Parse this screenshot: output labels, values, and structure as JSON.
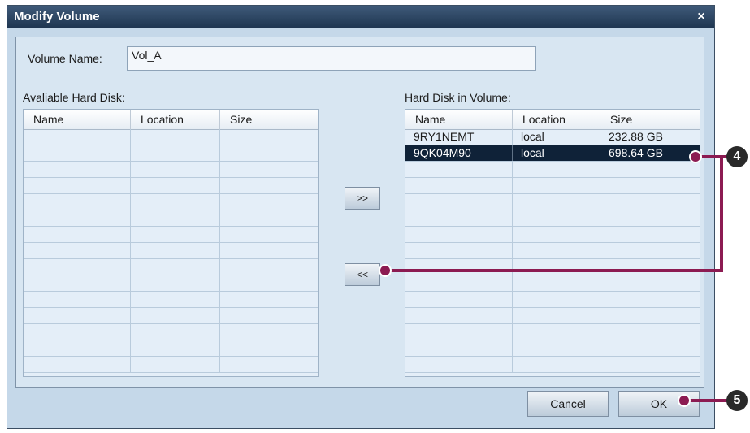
{
  "dialog": {
    "title": "Modify Volume",
    "close_glyph": "×",
    "volume_name_label": "Volume Name:",
    "volume_name_value": "Vol_A"
  },
  "available": {
    "label": "Avaliable Hard Disk:",
    "columns": [
      "Name",
      "Location",
      "Size"
    ],
    "rows": []
  },
  "in_volume": {
    "label": "Hard Disk in Volume:",
    "columns": [
      "Name",
      "Location",
      "Size"
    ],
    "rows": [
      {
        "name": "9RY1NEMT",
        "location": "local",
        "size": "232.88 GB",
        "selected": false
      },
      {
        "name": "9QK04M90",
        "location": "local",
        "size": "698.64 GB",
        "selected": true
      }
    ]
  },
  "buttons": {
    "add": ">>",
    "remove": "<<",
    "cancel": "Cancel",
    "ok": "OK"
  },
  "callouts": {
    "four": "4",
    "five": "5"
  },
  "colors": {
    "callout": "#8c1b52",
    "selection": "#0f2238",
    "titlebar": "#2a4463"
  }
}
